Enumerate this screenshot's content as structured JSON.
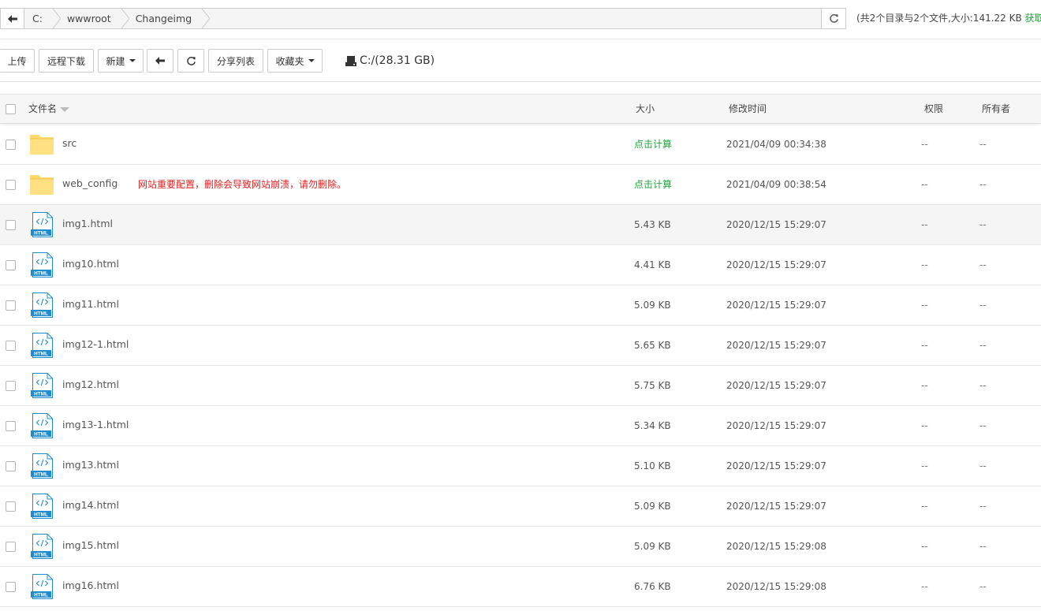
{
  "path": {
    "back_icon": "arrow-left-icon",
    "crumbs": [
      "C:",
      "wwwroot",
      "Changeimg"
    ],
    "refresh_icon": "refresh-icon",
    "summary": "(共2个目录与2个文件,大小:141.22 KB ",
    "summary_link": "获取)"
  },
  "toolbar": {
    "upload": "上传",
    "remote_download": "远程下载",
    "new": "新建",
    "back_icon": "arrow-left-icon",
    "refresh_icon": "refresh-icon",
    "share_list": "分享列表",
    "favorites": "收藏夹",
    "disk_icon": "hard-drive-icon",
    "disk": "C:/(28.31 GB)"
  },
  "table": {
    "headers": {
      "name": "文件名",
      "size": "大小",
      "mtime": "修改时间",
      "perm": "权限",
      "owner": "所有者"
    },
    "rows": [
      {
        "type": "folder",
        "name": "src",
        "note": "",
        "size": "点击计算",
        "mtime": "2021/04/09 00:34:38",
        "perm": "--",
        "owner": "--"
      },
      {
        "type": "folder",
        "name": "web_config",
        "note": "网站重要配置，删除会导致网站崩溃，请勿删除。",
        "size": "点击计算",
        "mtime": "2021/04/09 00:38:54",
        "perm": "--",
        "owner": "--"
      },
      {
        "type": "html",
        "name": "img1.html",
        "note": "",
        "size": "5.43 KB",
        "mtime": "2020/12/15 15:29:07",
        "perm": "--",
        "owner": "--"
      },
      {
        "type": "html",
        "name": "img10.html",
        "note": "",
        "size": "4.41 KB",
        "mtime": "2020/12/15 15:29:07",
        "perm": "--",
        "owner": "--"
      },
      {
        "type": "html",
        "name": "img11.html",
        "note": "",
        "size": "5.09 KB",
        "mtime": "2020/12/15 15:29:07",
        "perm": "--",
        "owner": "--"
      },
      {
        "type": "html",
        "name": "img12-1.html",
        "note": "",
        "size": "5.65 KB",
        "mtime": "2020/12/15 15:29:07",
        "perm": "--",
        "owner": "--"
      },
      {
        "type": "html",
        "name": "img12.html",
        "note": "",
        "size": "5.75 KB",
        "mtime": "2020/12/15 15:29:07",
        "perm": "--",
        "owner": "--"
      },
      {
        "type": "html",
        "name": "img13-1.html",
        "note": "",
        "size": "5.34 KB",
        "mtime": "2020/12/15 15:29:07",
        "perm": "--",
        "owner": "--"
      },
      {
        "type": "html",
        "name": "img13.html",
        "note": "",
        "size": "5.10 KB",
        "mtime": "2020/12/15 15:29:07",
        "perm": "--",
        "owner": "--"
      },
      {
        "type": "html",
        "name": "img14.html",
        "note": "",
        "size": "5.09 KB",
        "mtime": "2020/12/15 15:29:07",
        "perm": "--",
        "owner": "--"
      },
      {
        "type": "html",
        "name": "img15.html",
        "note": "",
        "size": "5.09 KB",
        "mtime": "2020/12/15 15:29:08",
        "perm": "--",
        "owner": "--"
      },
      {
        "type": "html",
        "name": "img16.html",
        "note": "",
        "size": "6.76 KB",
        "mtime": "2020/12/15 15:29:08",
        "perm": "--",
        "owner": "--"
      }
    ]
  },
  "colors": {
    "accent_green": "#20a53a",
    "warning_red": "#e02020",
    "folder_yellow": "#ffd96b",
    "html_blue": "#1f8ccf"
  }
}
